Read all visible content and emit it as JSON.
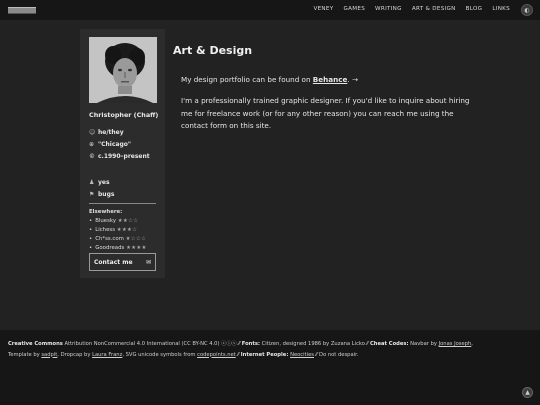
{
  "nav": {
    "items": [
      "VENEY",
      "GAMES",
      "WRITING",
      "ART & DESIGN",
      "BLOG",
      "LINKS"
    ],
    "theme_toggle_icon": "◐"
  },
  "profile": {
    "name": "Christopher (Chaff)",
    "pronouns": "he/they",
    "location": "\"Chicago\"",
    "born": "c.1990–present",
    "extra1": "yes",
    "extra2": "bugs",
    "elsewhere_heading": "Elsewhere:",
    "elsewhere": [
      {
        "label": "Bluesky",
        "stars": "★★☆☆"
      },
      {
        "label": "Lichess",
        "stars": "★★★☆"
      },
      {
        "label": "Ch*ss.com",
        "stars": "★☆☆☆"
      },
      {
        "label": "Goodreads",
        "stars": "★★★★"
      }
    ],
    "contact_label": "Contact me",
    "contact_icon": "✉"
  },
  "content": {
    "title": "Art & Design",
    "p1_prefix": "My design portfolio can be found on ",
    "p1_link": "Behance",
    "p1_suffix": ". →",
    "p2": "I'm a professionally trained graphic designer. If you'd like to inquire about hiring me for freelance work (or for any other reason) you can reach me using the contact form on this site."
  },
  "footer": {
    "cc_bold": "Creative Commons",
    "cc_text": " Attribution NonCommercial 4.0 International (CC BY-NC 4.0) ⓒⓘⓢ ⁄⁄ ",
    "fonts_label": "Fonts:",
    "fonts_text": " Citizen, designed 1986 by Zuzana Licko ⁄⁄ ",
    "cheat_label": "Cheat Codes:",
    "cheat_text": " Navbar by ",
    "navbar_author": "Jonas Joseph",
    "line2_a": "Template by ",
    "template_author": "sadpit",
    "line2_b": ", Dropcap by ",
    "dropcap_author": "Laura Franz",
    "line2_c": ", SVG unicode symbols from ",
    "svg_source": "codepoints.net",
    "line2_d": " ⁄⁄ ",
    "internet_label": "Internet People:",
    "line2_e": " ",
    "internet_link": "Neocities",
    "line2_f": " ⁄⁄ Do not despair.",
    "up_icon": "▲"
  }
}
